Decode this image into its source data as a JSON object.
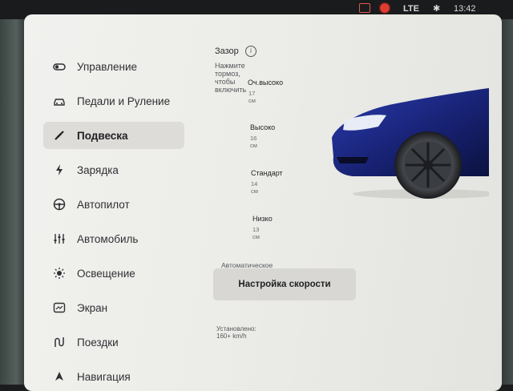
{
  "status": {
    "lte": "LTE",
    "bluetooth_icon": "bluetooth-icon",
    "time": "13:42"
  },
  "nav": [
    {
      "label": "Управление",
      "icon": "toggle-icon"
    },
    {
      "label": "Педали и Руление",
      "icon": "car-icon"
    },
    {
      "label": "Подвеска",
      "icon": "suspension-icon",
      "active": true
    },
    {
      "label": "Зарядка",
      "icon": "bolt-icon"
    },
    {
      "label": "Автопилот",
      "icon": "steering-wheel-icon"
    },
    {
      "label": "Автомобиль",
      "icon": "sliders-icon"
    },
    {
      "label": "Освещение",
      "icon": "sun-icon"
    },
    {
      "label": "Экран",
      "icon": "display-icon"
    },
    {
      "label": "Поездки",
      "icon": "trips-icon"
    },
    {
      "label": "Навигация",
      "icon": "navigation-icon"
    }
  ],
  "suspension": {
    "title": "Зазор",
    "hint": "Нажмите тормоз, чтобы включить",
    "options": [
      {
        "name": "Оч.высоко",
        "value": "17 см"
      },
      {
        "name": "Высоко",
        "value": "16 см"
      },
      {
        "name": "Стандарт",
        "value": "14 см"
      },
      {
        "name": "Низко",
        "value": "13 см"
      }
    ],
    "auto_label": "Автоматическое Снижение",
    "speed_button": "Настройка скорости",
    "installed": "Установлено: 160+ km/h"
  },
  "colors": {
    "car": "#1c2a8a",
    "accent": "#e03b2f"
  }
}
